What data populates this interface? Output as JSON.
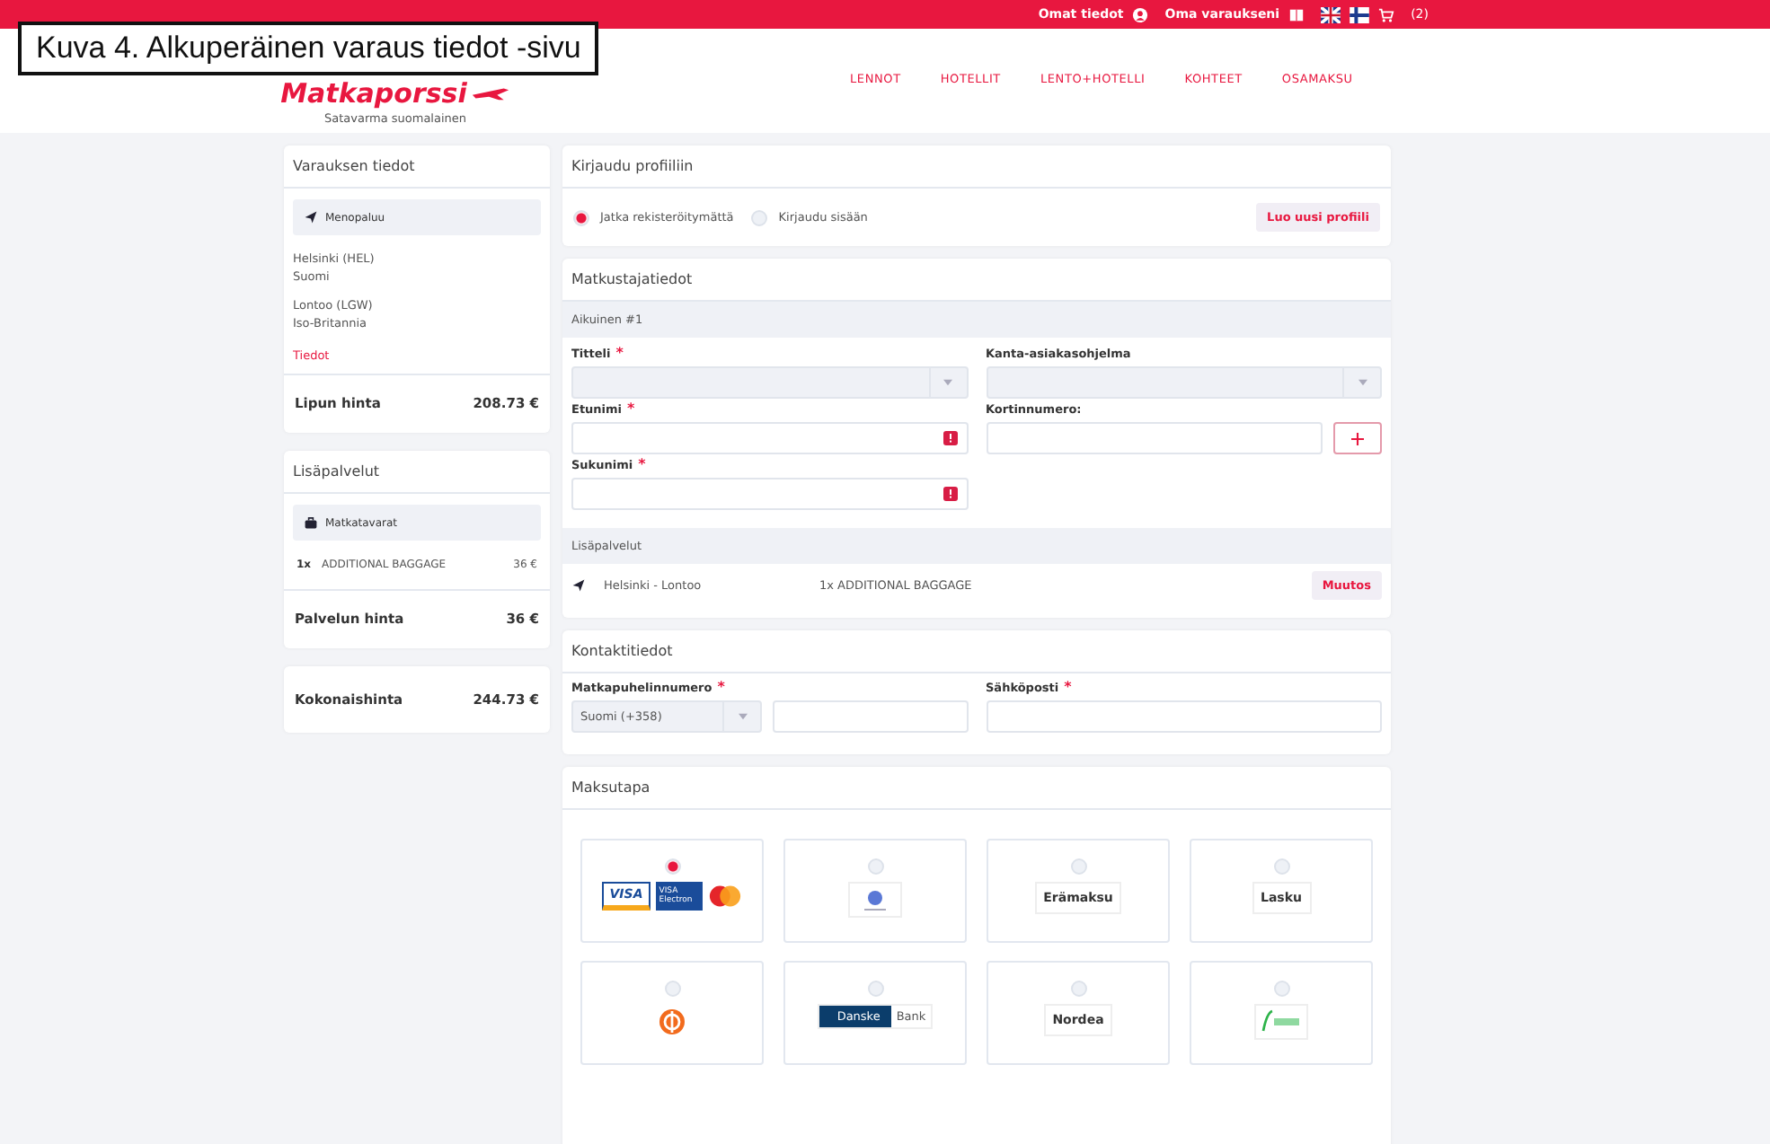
{
  "caption": "Kuva 4. Alkuperäinen varaus tiedot -sivu",
  "topbar": {
    "profile": "Omat tiedot",
    "booking": "Oma varaukseni",
    "cart": "(2)"
  },
  "logo": {
    "name": "Matkaporssi",
    "tagline": "Satavarma suomalainen"
  },
  "nav": [
    "LENNOT",
    "HOTELLIT",
    "LENTO+HOTELLI",
    "KOHTEET",
    "OSAMAKSU"
  ],
  "summary": {
    "title": "Varauksen tiedot",
    "segment": "Menopaluu",
    "from": "Helsinki (HEL)",
    "from_country": "Suomi",
    "to": "Lontoo (LGW)",
    "to_country": "Iso-Britannia",
    "details_link": "Tiedot",
    "price_label": "Lipun hinta",
    "price": "208.73 €"
  },
  "extras": {
    "title": "Lisäpalvelut",
    "group": "Matkatavarat",
    "qty": "1x",
    "item": "ADDITIONAL BAGGAGE",
    "item_price": "36 €",
    "price_label": "Palvelun hinta",
    "price": "36 €"
  },
  "total": {
    "label": "Kokonaishinta",
    "price": "244.73 €"
  },
  "login": {
    "title": "Kirjaudu profiiliin",
    "options": [
      {
        "label": "Jatka rekisteröitymättä",
        "selected": true
      },
      {
        "label": "Kirjaudu sisään",
        "selected": false
      }
    ],
    "button": "Luo uusi profiili"
  },
  "travellers": {
    "title": "Matkustajatiedot",
    "passenger": "Aikuinen #1",
    "fields": [
      {
        "label": "Titteli",
        "required_mark": "*",
        "kind": "select",
        "error": false
      },
      {
        "label": "Kanta-asiakasohjelma",
        "kind": "select",
        "error": false
      },
      {
        "label": "Etunimi",
        "required_mark": "*",
        "kind": "text",
        "error": true
      },
      {
        "label": "Kortinnumero:",
        "kind": "add",
        "error": false
      },
      {
        "label": "Sukunimi",
        "required_mark": "*",
        "kind": "text",
        "error": true
      }
    ],
    "services_title": "Lisäpalvelut",
    "service_route": "Helsinki - Lontoo",
    "service_item": "1x ADDITIONAL BAGGAGE",
    "service_button": "Muutos"
  },
  "contact": {
    "title": "Kontaktitiedot",
    "phone_label": "Matkapuhelinnumero",
    "phone_required_mark": "*",
    "phone_country": "Suomi (+358)",
    "email_label": "Sähköposti",
    "email_required_mark": "*"
  },
  "payment": {
    "title": "Maksutapa",
    "options": [
      {
        "kind": "cards",
        "selected": true,
        "labels": [
          "VISA",
          "VISA Electron"
        ]
      },
      {
        "kind": "mobilepay",
        "selected": false
      },
      {
        "kind": "text",
        "selected": false,
        "labels": [
          "Erämaksu"
        ]
      },
      {
        "kind": "text",
        "selected": false,
        "labels": [
          "Lasku"
        ]
      },
      {
        "kind": "op",
        "selected": false
      },
      {
        "kind": "danske",
        "selected": false,
        "labels": [
          "Danske",
          "Bank"
        ]
      },
      {
        "kind": "text",
        "selected": false,
        "labels": [
          "Nordea"
        ]
      },
      {
        "kind": "green",
        "selected": false
      }
    ]
  }
}
